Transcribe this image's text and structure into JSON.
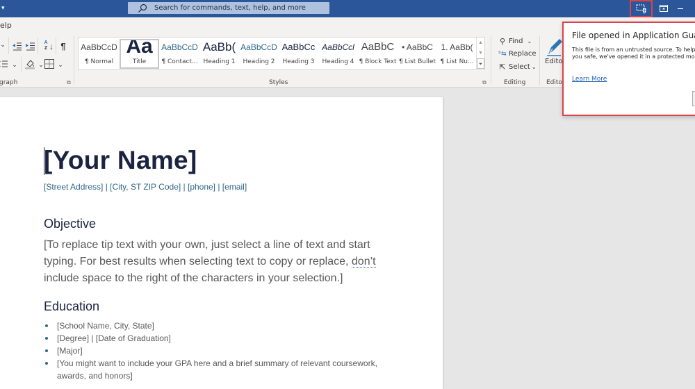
{
  "titlebar": {
    "search_placeholder": "Search for commands, text, help, and more"
  },
  "tabs": {
    "help_label": "elp"
  },
  "ribbon": {
    "groups": {
      "paragraph": "graph",
      "styles": "Styles",
      "editing": "Editing",
      "editor": "Editor"
    },
    "styles": [
      {
        "sample": "AaBbCcD",
        "name": "¶ Normal"
      },
      {
        "sample": "Aa",
        "name": "Title"
      },
      {
        "sample": "AaBbCcD",
        "name": "¶ Contact..."
      },
      {
        "sample": "AaBb(",
        "name": "Heading 1"
      },
      {
        "sample": "AaBbCcD",
        "name": "Heading 2"
      },
      {
        "sample": "AaBbCc",
        "name": "Heading 3"
      },
      {
        "sample": "AaBbCcl",
        "name": "Heading 4"
      },
      {
        "sample": "AaBbC",
        "name": "¶ Block Text"
      },
      {
        "sample": "• AaBbC",
        "name": "¶ List Bullet"
      },
      {
        "sample": "1. AaBb(",
        "name": "¶ List Nu..."
      }
    ],
    "editing": {
      "find": "Find",
      "replace": "Replace",
      "select": "Select"
    },
    "editor_label": "Editor"
  },
  "document": {
    "name": "[Your Name]",
    "contact": "[Street Address] | [City, ST ZIP Code] | [phone] | [email]",
    "objective_heading": "Objective",
    "objective_text_a": "[To replace tip text with your own, just select a line of text and start typing. For best results when selecting text to copy or replace, ",
    "objective_text_dont": "don’t",
    "objective_text_b": " include space to the right of the characters in your selection.]",
    "education_heading": "Education",
    "education_items": [
      "[School Name, City, State]",
      "[Degree] | [Date of Graduation]",
      "[Major]",
      "[You might want to include your GPA here and a brief summary of relevant coursework, awards, and honors]"
    ]
  },
  "popup": {
    "title": "File opened in Application Guard",
    "body": "This file is from an untrusted source. To help keep you safe, we've opened it in a protected mode.",
    "link": "Learn More"
  },
  "colors": {
    "titlebar": "#2b579a",
    "highlight_border": "#d9434a",
    "heading": "#1a2340",
    "accent": "#2f6786"
  }
}
